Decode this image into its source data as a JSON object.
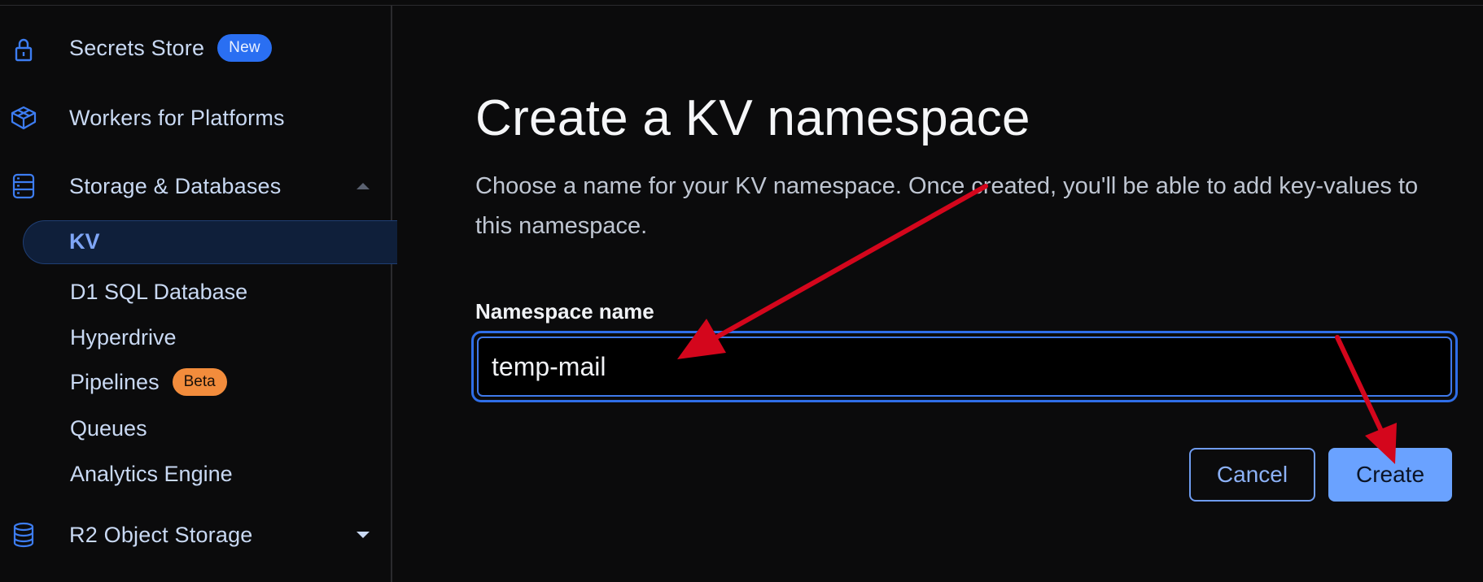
{
  "sidebar": {
    "items": [
      {
        "label": "Secrets Store",
        "badge": "New",
        "icon": "lock-icon"
      },
      {
        "label": "Workers for Platforms",
        "icon": "cube-icon"
      },
      {
        "label": "Storage & Databases",
        "icon": "database-list-icon",
        "expanded": true
      },
      {
        "label": "R2 Object Storage",
        "icon": "database-icon",
        "expanded": false
      }
    ],
    "sub_items": [
      {
        "label": "KV",
        "active": true
      },
      {
        "label": "D1 SQL Database"
      },
      {
        "label": "Hyperdrive"
      },
      {
        "label": "Pipelines",
        "badge": "Beta"
      },
      {
        "label": "Queues"
      },
      {
        "label": "Analytics Engine"
      }
    ]
  },
  "main": {
    "title": "Create a KV namespace",
    "description": "Choose a name for your KV namespace. Once created, you'll be able to add key-values to this namespace.",
    "field_label": "Namespace name",
    "field_value": "temp-mail",
    "cancel_label": "Cancel",
    "create_label": "Create"
  },
  "colors": {
    "accent": "#2f6ee8",
    "create_button": "#6aa2ff",
    "badge_new": "#2a6ff2",
    "badge_beta": "#f28c3c",
    "annotation_arrow": "#d4061c"
  }
}
